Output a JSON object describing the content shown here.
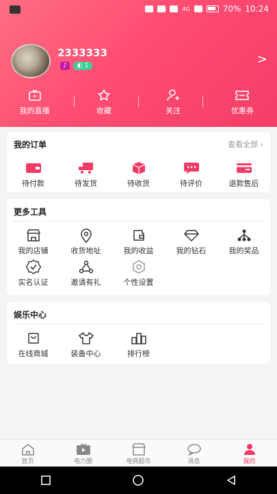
{
  "status": {
    "battery": "70%",
    "time": "10:24",
    "network": "4G"
  },
  "profile": {
    "username": "2333333",
    "level_badge": "1",
    "arrow": ">"
  },
  "quick": [
    {
      "label": "我的直播",
      "icon": "live-tv-icon"
    },
    {
      "label": "收藏",
      "icon": "star-icon"
    },
    {
      "label": "关注",
      "icon": "user-follow-icon"
    },
    {
      "label": "优惠券",
      "icon": "coupon-icon"
    }
  ],
  "orders": {
    "title": "我的订单",
    "view_all": "查看全部",
    "items": [
      {
        "label": "待付款",
        "icon": "wallet-icon"
      },
      {
        "label": "待发货",
        "icon": "truck-icon"
      },
      {
        "label": "待收货",
        "icon": "package-icon"
      },
      {
        "label": "待评价",
        "icon": "chat-bubble-icon"
      },
      {
        "label": "退款售后",
        "icon": "refund-card-icon"
      }
    ]
  },
  "tools": {
    "title": "更多工具",
    "items": [
      {
        "label": "我的店铺",
        "icon": "shop-icon"
      },
      {
        "label": "收货地址",
        "icon": "location-pin-icon"
      },
      {
        "label": "我的收益",
        "icon": "earnings-wallet-icon"
      },
      {
        "label": "我的钻石",
        "icon": "diamond-icon"
      },
      {
        "label": "我的奖品",
        "icon": "prize-tree-icon"
      },
      {
        "label": "实名认证",
        "icon": "verify-badge-icon"
      },
      {
        "label": "邀请有礼",
        "icon": "share-network-icon"
      },
      {
        "label": "个性设置",
        "icon": "settings-hex-icon"
      }
    ]
  },
  "entertainment": {
    "title": "娱乐中心",
    "items": [
      {
        "label": "在线商城",
        "icon": "shopping-bag-icon"
      },
      {
        "label": "装备中心",
        "icon": "tshirt-icon"
      },
      {
        "label": "排行榜",
        "icon": "ranking-icon"
      }
    ]
  },
  "nav": [
    {
      "label": "首页",
      "icon": "home-icon"
    },
    {
      "label": "电力圈",
      "icon": "video-circle-icon"
    },
    {
      "label": "电商超市",
      "icon": "store-icon"
    },
    {
      "label": "消息",
      "icon": "message-icon"
    },
    {
      "label": "我的",
      "icon": "profile-icon"
    }
  ],
  "colors": {
    "accent": "#f23a66",
    "gradient_start": "#ff6f83"
  }
}
